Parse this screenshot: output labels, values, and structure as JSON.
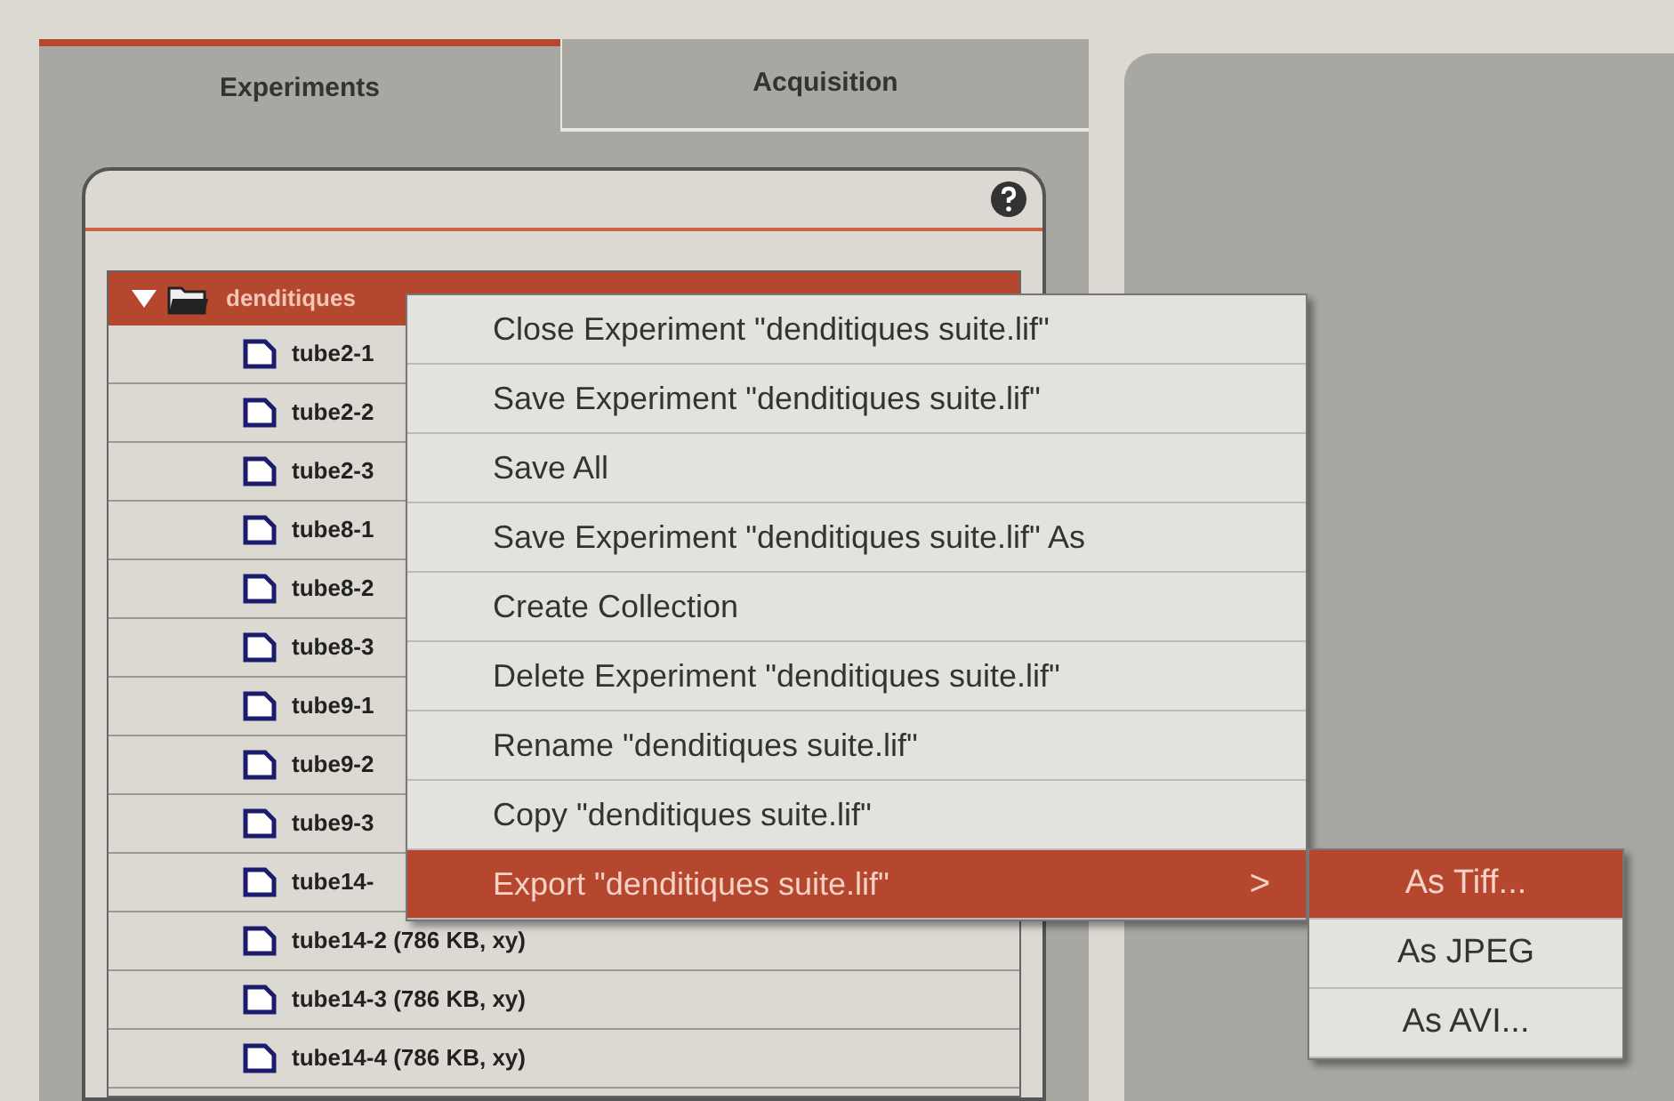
{
  "tabs": [
    {
      "label": "Experiments",
      "selected": true
    },
    {
      "label": "Acquisition",
      "selected": false
    }
  ],
  "tree": {
    "label": "denditiques",
    "expanded": true,
    "selected": true,
    "children": [
      {
        "label": "tube2-1"
      },
      {
        "label": "tube2-2"
      },
      {
        "label": "tube2-3"
      },
      {
        "label": "tube8-1"
      },
      {
        "label": "tube8-2"
      },
      {
        "label": "tube8-3"
      },
      {
        "label": "tube9-1"
      },
      {
        "label": "tube9-2"
      },
      {
        "label": "tube9-3"
      },
      {
        "label": "tube14-"
      },
      {
        "label": "tube14-2 (786 KB, xy)"
      },
      {
        "label": "tube14-3 (786 KB, xy)"
      },
      {
        "label": "tube14-4 (786 KB, xy)"
      }
    ]
  },
  "context_menu": [
    {
      "label": "Close Experiment \"denditiques suite.lif\"",
      "selected": false
    },
    {
      "label": "Save Experiment \"denditiques suite.lif\"",
      "selected": false
    },
    {
      "label": "Save All",
      "selected": false
    },
    {
      "label": "Save Experiment \"denditiques suite.lif\" As",
      "selected": false
    },
    {
      "label": "Create Collection",
      "selected": false
    },
    {
      "label": "Delete Experiment \"denditiques suite.lif\"",
      "selected": false
    },
    {
      "label": "Rename \"denditiques suite.lif\"",
      "selected": false
    },
    {
      "label": "Copy \"denditiques suite.lif\"",
      "selected": false
    },
    {
      "label": "Export \"denditiques suite.lif\"",
      "selected": true,
      "submenu_arrow": ">"
    }
  ],
  "submenu": [
    {
      "label": "As Tiff...",
      "selected": true
    },
    {
      "label": "As JPEG",
      "selected": false
    },
    {
      "label": "As AVI...",
      "selected": false
    }
  ]
}
